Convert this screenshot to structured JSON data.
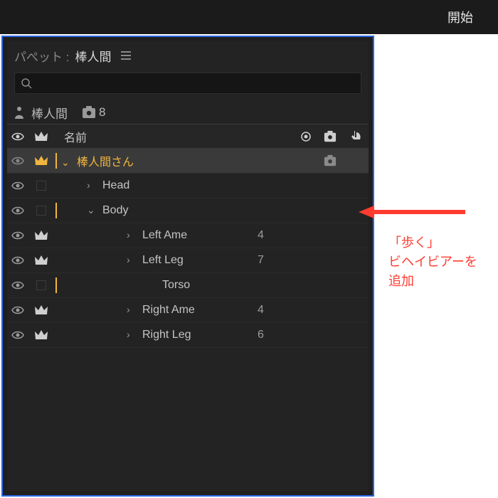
{
  "topbar": {
    "start_label": "開始"
  },
  "panel": {
    "title_prefix": "パぺット :",
    "title_name": "棒人間",
    "search_placeholder": "",
    "puppet_name": "棒人間",
    "behavior_count": "8",
    "columns": {
      "name_header": "名前"
    }
  },
  "rows": [
    {
      "id": "root",
      "name": "棒人間さん",
      "crown": "gold",
      "eye": true,
      "bar": "gold",
      "expand": "down",
      "indent": 0,
      "val": "",
      "selected": true,
      "gear": true
    },
    {
      "id": "head",
      "name": "Head",
      "crown": "box",
      "eye": true,
      "bar": "none",
      "expand": "right",
      "indent": 1,
      "val": "",
      "selected": false
    },
    {
      "id": "body",
      "name": "Body",
      "crown": "box",
      "eye": true,
      "bar": "gold",
      "expand": "down",
      "indent": 1,
      "val": "",
      "selected": false
    },
    {
      "id": "larm",
      "name": "Left Ame",
      "crown": "white",
      "eye": true,
      "bar": "none",
      "expand": "right",
      "indent": 2,
      "val": "4",
      "selected": false
    },
    {
      "id": "lleg",
      "name": "Left Leg",
      "crown": "white",
      "eye": true,
      "bar": "none",
      "expand": "right",
      "indent": 2,
      "val": "7",
      "selected": false
    },
    {
      "id": "torso",
      "name": "Torso",
      "crown": "box",
      "eye": true,
      "bar": "gold",
      "expand": "none",
      "indent": 2,
      "val": "",
      "selected": false,
      "torso": true
    },
    {
      "id": "rarm",
      "name": "Right Ame",
      "crown": "white",
      "eye": true,
      "bar": "none",
      "expand": "right",
      "indent": 2,
      "val": "4",
      "selected": false
    },
    {
      "id": "rleg",
      "name": "Right Leg",
      "crown": "white",
      "eye": true,
      "bar": "none",
      "expand": "right",
      "indent": 2,
      "val": "6",
      "selected": false
    }
  ],
  "annotation": {
    "line1": "「歩く」",
    "line2": "ビヘイビアーを",
    "line3": "追加"
  },
  "colors": {
    "accent": "#f1b63e",
    "blue": "#2a66ea",
    "red": "#ff3b30"
  }
}
